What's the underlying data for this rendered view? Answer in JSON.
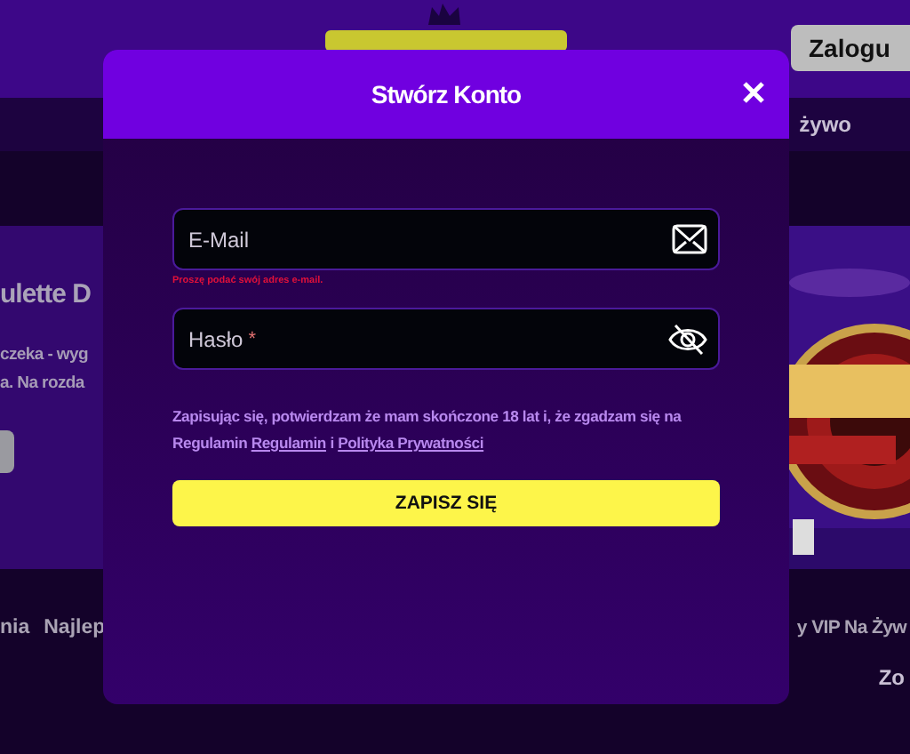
{
  "header": {
    "login_button": "Zalogu"
  },
  "nav": {
    "items": [
      "żywo"
    ]
  },
  "hero": {
    "title": "ulette D",
    "text_lines": [
      "czeka - wyg",
      "a. Na rozda"
    ]
  },
  "bottom_nav": {
    "left": [
      "nia",
      "Najlep"
    ],
    "right": [
      "y VIP Na Żyw"
    ]
  },
  "footer": {
    "right": "Zo"
  },
  "modal": {
    "title": "Stwórz Konto",
    "fields": [
      {
        "kind": "email",
        "placeholder": "E-Mail",
        "error": "Proszę podać swój adres e-mail."
      },
      {
        "kind": "password",
        "placeholder": "Hasło",
        "required_mark": "*"
      }
    ],
    "terms": {
      "text": "Zapisując się, potwierdzam że mam skończone 18 lat i, że zgadzam się na Regulamin",
      "links": [
        "Regulamin",
        "Polityka Prywatności"
      ],
      "joiner": "i"
    },
    "submit": "ZAPISZ SIĘ"
  }
}
